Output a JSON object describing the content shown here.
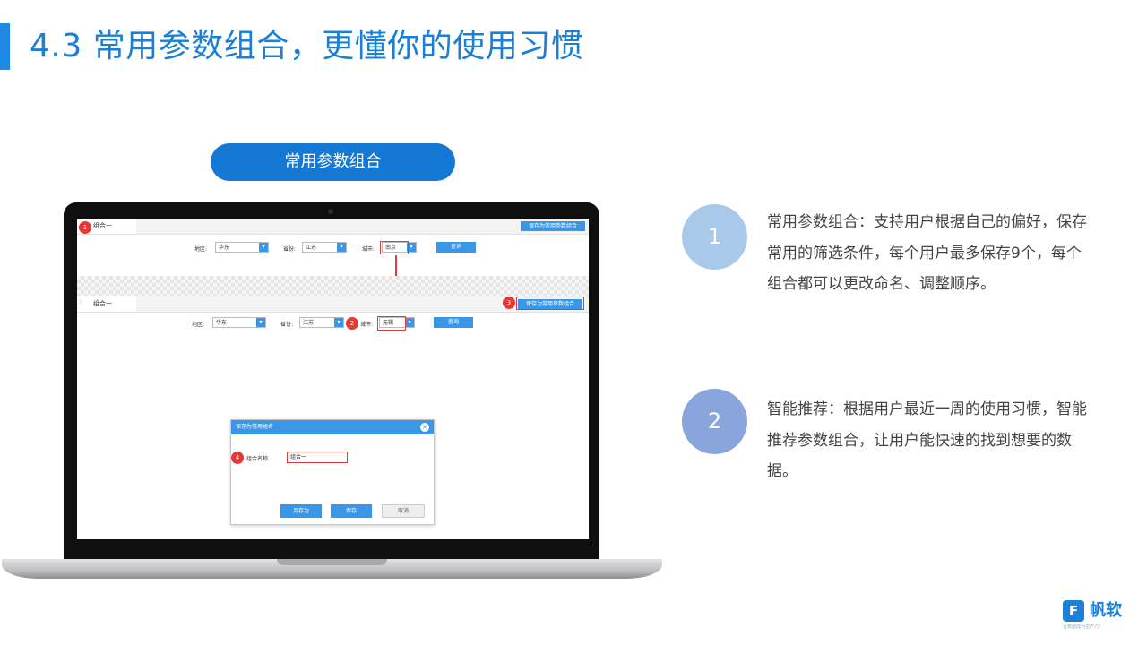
{
  "slide": {
    "title": "4.3 常用参数组合，更懂你的使用习惯",
    "pill_label": "常用参数组合",
    "colors": {
      "accent": "#1478d4",
      "circle1": "#a9c9ea",
      "circle2": "#8aa4dc",
      "highlight": "#e53935"
    }
  },
  "screen": {
    "top_tab": "组合一",
    "top_save": "保存为常用参数组合",
    "filters_top": {
      "region_label": "地区:",
      "region_value": "华东",
      "province_label": "省份:",
      "province_value": "江苏",
      "city_label": "城市:",
      "city_value": "南京",
      "query": "查询"
    },
    "bottom_tab": "组合一",
    "bottom_save": "保存为常用参数组合",
    "filters_bottom": {
      "region_label": "地区:",
      "region_value": "华东",
      "province_label": "省份:",
      "province_value": "江苏",
      "city_label": "城市:",
      "city_value": "无锡",
      "query": "查询"
    },
    "badges": [
      "1",
      "2",
      "3",
      "4"
    ],
    "dialog": {
      "title": "保存为常用组合",
      "name_label": "组合名称",
      "name_value": "组合一",
      "save_as": "另存为",
      "save": "保存",
      "cancel": "取消"
    }
  },
  "features": [
    {
      "num": "1",
      "text": "常用参数组合：支持用户根据自己的偏好，保存常用的筛选条件，每个用户最多保存9个，每个组合都可以更改命名、调整顺序。"
    },
    {
      "num": "2",
      "text": "智能推荐：根据用户最近一周的使用习惯，智能推荐参数组合，让用户能快速的找到想要的数据。"
    }
  ],
  "logo": {
    "mark": "F",
    "name": "帆软",
    "tagline": "让数据成为生产力!"
  }
}
